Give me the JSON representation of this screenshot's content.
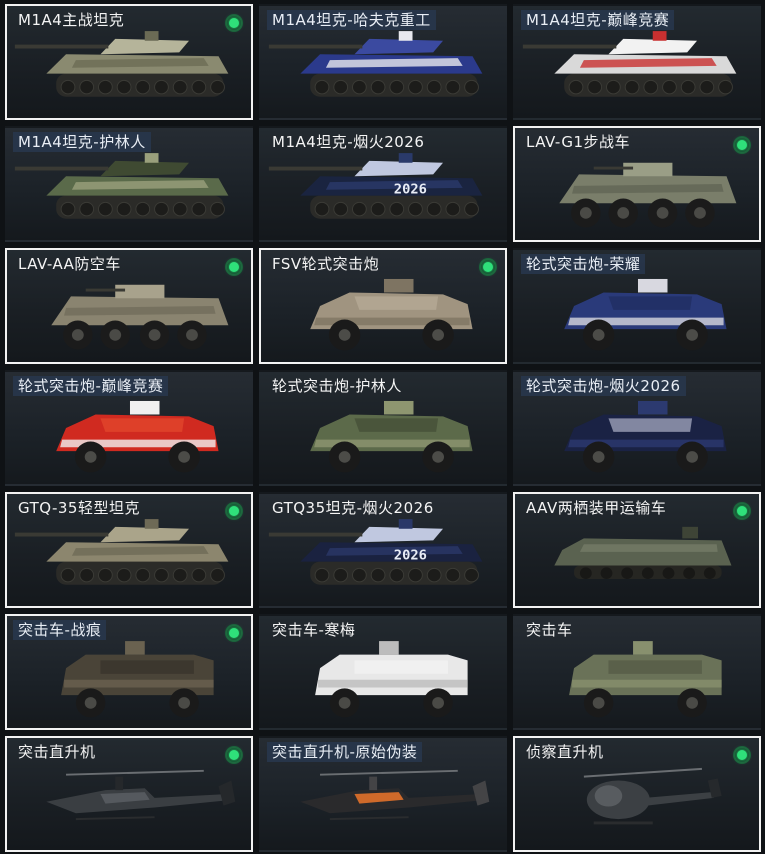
{
  "vehicles": [
    {
      "name": "M1A4主战坦克",
      "owned": true,
      "selected": true,
      "kind": "tank",
      "colors": [
        "#8a8a70",
        "#6b6b55",
        "#b5b49a"
      ],
      "tag": false
    },
    {
      "name": "M1A4坦克-哈夫克重工",
      "owned": false,
      "selected": false,
      "kind": "tank",
      "colors": [
        "#2b3a8c",
        "#e8e8ee",
        "#3b4aa0"
      ],
      "tag": true
    },
    {
      "name": "M1A4坦克-巅峰竞赛",
      "owned": false,
      "selected": false,
      "kind": "tank",
      "colors": [
        "#d9d9d9",
        "#c83030",
        "#f2f2f2"
      ],
      "tag": true
    },
    {
      "name": "M1A4坦克-护林人",
      "owned": false,
      "selected": false,
      "kind": "tank",
      "colors": [
        "#5a6a4a",
        "#9aa07c",
        "#3f4a32"
      ],
      "tag": true
    },
    {
      "name": "M1A4坦克-烟火2026",
      "owned": false,
      "selected": false,
      "kind": "tank",
      "colors": [
        "#1a2440",
        "#2a3a6a",
        "#c0c8e0"
      ],
      "tag": false,
      "plate": "2026"
    },
    {
      "name": "LAV-G1步战车",
      "owned": true,
      "selected": true,
      "kind": "apc",
      "colors": [
        "#7a7e6a",
        "#5e6252",
        "#9a9e86"
      ],
      "tag": false
    },
    {
      "name": "LAV-AA防空车",
      "owned": true,
      "selected": true,
      "kind": "apc",
      "colors": [
        "#8a8470",
        "#6e6a58",
        "#a8a28c"
      ],
      "tag": false
    },
    {
      "name": "FSV轮式突击炮",
      "owned": true,
      "selected": true,
      "kind": "car",
      "colors": [
        "#a09480",
        "#7e7462",
        "#bdb19c"
      ],
      "tag": false
    },
    {
      "name": "轮式突击炮-荣耀",
      "owned": false,
      "selected": false,
      "kind": "car",
      "colors": [
        "#2a3a7a",
        "#d8d8e0",
        "#1e2a5a"
      ],
      "tag": true
    },
    {
      "name": "轮式突击炮-巅峰竞赛",
      "owned": false,
      "selected": false,
      "kind": "car",
      "colors": [
        "#d02a20",
        "#f0f0f0",
        "#e85030"
      ],
      "tag": true
    },
    {
      "name": "轮式突击炮-护林人",
      "owned": false,
      "selected": false,
      "kind": "car",
      "colors": [
        "#5c6a4a",
        "#8e9670",
        "#3e4832"
      ],
      "tag": false
    },
    {
      "name": "轮式突击炮-烟火2026",
      "owned": false,
      "selected": false,
      "kind": "car",
      "colors": [
        "#1a2244",
        "#2c3a70",
        "#c8cce0"
      ],
      "tag": true
    },
    {
      "name": "GTQ-35轻型坦克",
      "owned": true,
      "selected": true,
      "kind": "tank",
      "colors": [
        "#8c866e",
        "#6e6a56",
        "#aaa48a"
      ],
      "tag": false
    },
    {
      "name": "GTQ35坦克-烟火2026",
      "owned": false,
      "selected": false,
      "kind": "tank",
      "colors": [
        "#1a2240",
        "#2a3868",
        "#c0c8e0"
      ],
      "tag": false,
      "plate": "2026"
    },
    {
      "name": "AAV两栖装甲运输车",
      "owned": true,
      "selected": true,
      "kind": "amphib",
      "colors": [
        "#5a6250",
        "#747c66",
        "#3e4436"
      ],
      "tag": false
    },
    {
      "name": "突击车-战痕",
      "owned": true,
      "selected": true,
      "kind": "mrap",
      "colors": [
        "#4a4438",
        "#6a6250",
        "#322e26"
      ],
      "tag": true
    },
    {
      "name": "突击车-寒梅",
      "owned": false,
      "selected": false,
      "kind": "mrap",
      "colors": [
        "#e8e8e8",
        "#bcbcbc",
        "#f6f6f6"
      ],
      "tag": false
    },
    {
      "name": "突击车",
      "owned": false,
      "selected": false,
      "kind": "mrap",
      "colors": [
        "#6a7258",
        "#88906e",
        "#4c5240"
      ],
      "tag": false
    },
    {
      "name": "突击直升机",
      "owned": true,
      "selected": true,
      "kind": "heli",
      "colors": [
        "#3a3e42",
        "#55595e",
        "#25282b"
      ],
      "tag": false
    },
    {
      "name": "突击直升机-原始伪装",
      "owned": false,
      "selected": false,
      "kind": "heli",
      "colors": [
        "#2a2a2c",
        "#d06a2a",
        "#444446"
      ],
      "tag": true
    },
    {
      "name": "侦察直升机",
      "owned": true,
      "selected": true,
      "kind": "smallheli",
      "colors": [
        "#3c4044",
        "#585c60",
        "#26292c"
      ],
      "tag": false
    }
  ]
}
